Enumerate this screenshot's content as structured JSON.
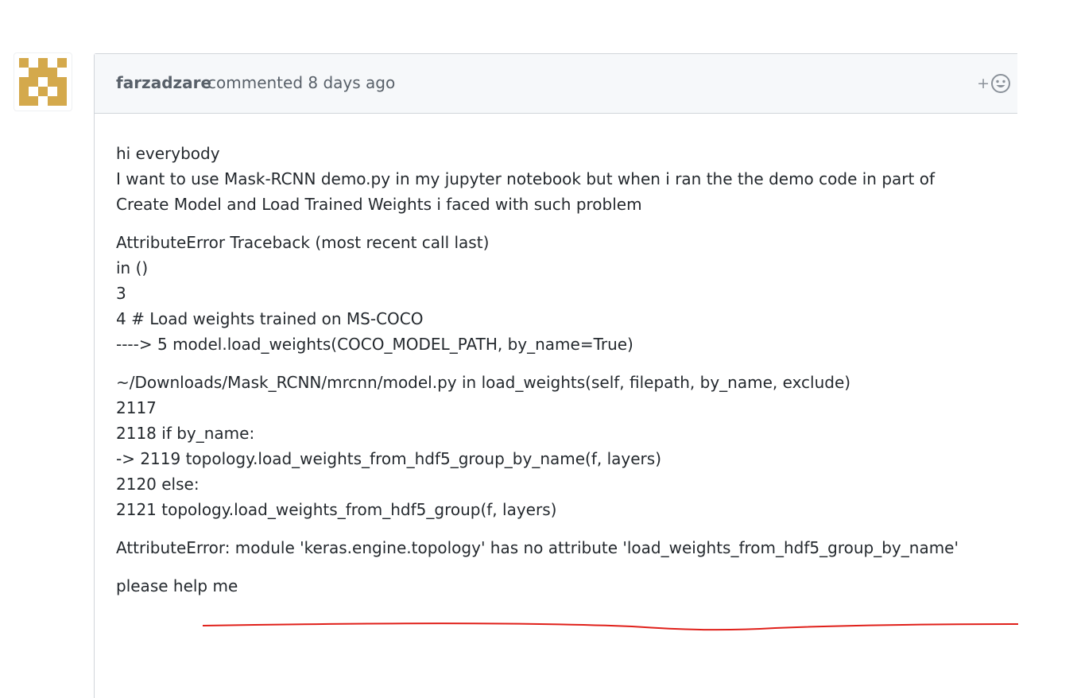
{
  "comment": {
    "author": "farzadzare",
    "meta": "commented 8 days ago",
    "reaction_plus": "+",
    "body": {
      "intro": [
        "hi everybody",
        "I want to use Mask-RCNN demo.py in my jupyter notebook but when i ran the the demo code in part of",
        "Create Model and Load Trained Weights i faced with such problem"
      ],
      "traceback_1": [
        "AttributeError Traceback (most recent call last)",
        "in ()",
        "3",
        "4 # Load weights trained on MS-COCO",
        "----> 5 model.load_weights(COCO_MODEL_PATH, by_name=True)"
      ],
      "traceback_2": [
        "~/Downloads/Mask_RCNN/mrcnn/model.py in load_weights(self, filepath, by_name, exclude)",
        "2117",
        "2118 if by_name:",
        "-> 2119 topology.load_weights_from_hdf5_group_by_name(f, layers)",
        "2120 else:",
        "2121 topology.load_weights_from_hdf5_group(f, layers)"
      ],
      "error": "AttributeError: module 'keras.engine.topology' has no attribute 'load_weights_from_hdf5_group_by_name'",
      "closing": "please help me"
    }
  },
  "colors": {
    "avatar": "#d4a94c",
    "underline": "#e0201a",
    "header_bg": "#f6f8fa",
    "border": "#d1d5da"
  },
  "icons": {
    "reaction": "smiley-icon",
    "avatar": "identicon"
  }
}
